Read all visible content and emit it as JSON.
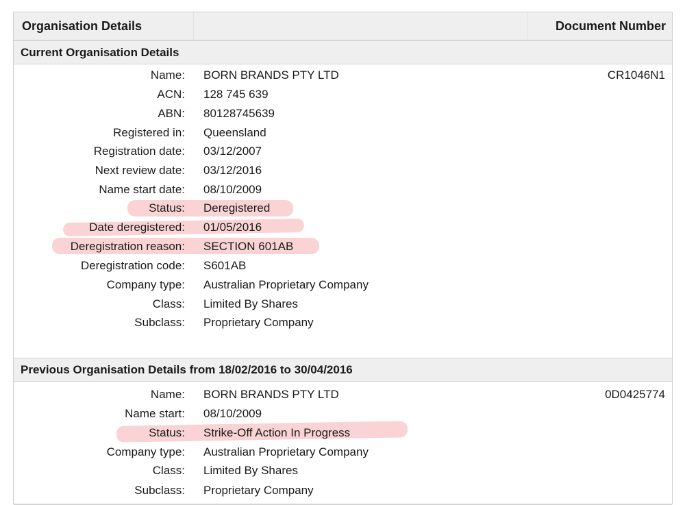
{
  "header": {
    "title": "Organisation Details",
    "document_number_label": "Document Number"
  },
  "current": {
    "section_title": "Current Organisation Details",
    "document_number": "CR1046N1",
    "fields": [
      {
        "label": "Name:",
        "value": "BORN BRANDS PTY LTD"
      },
      {
        "label": "ACN:",
        "value": "128 745 639"
      },
      {
        "label": "ABN:",
        "value": "80128745639"
      },
      {
        "label": "Registered in:",
        "value": "Queensland"
      },
      {
        "label": "Registration date:",
        "value": "03/12/2007"
      },
      {
        "label": "Next review date:",
        "value": "03/12/2016"
      },
      {
        "label": "Name start date:",
        "value": "08/10/2009"
      },
      {
        "label": "Status:",
        "value": "Deregistered"
      },
      {
        "label": "Date deregistered:",
        "value": "01/05/2016"
      },
      {
        "label": "Deregistration reason:",
        "value": "SECTION 601AB"
      },
      {
        "label": "Deregistration code:",
        "value": "S601AB"
      },
      {
        "label": "Company type:",
        "value": "Australian Proprietary Company"
      },
      {
        "label": "Class:",
        "value": "Limited By Shares"
      },
      {
        "label": "Subclass:",
        "value": "Proprietary Company"
      }
    ]
  },
  "previous": {
    "section_title": "Previous Organisation Details from 18/02/2016 to 30/04/2016",
    "document_number": "0D0425774",
    "fields": [
      {
        "label": "Name:",
        "value": "BORN BRANDS PTY LTD"
      },
      {
        "label": "Name start:",
        "value": "08/10/2009"
      },
      {
        "label": "Status:",
        "value": "Strike-Off Action In Progress"
      },
      {
        "label": "Company type:",
        "value": "Australian Proprietary Company"
      },
      {
        "label": "Class:",
        "value": "Limited By Shares"
      },
      {
        "label": "Subclass:",
        "value": "Proprietary Company"
      }
    ]
  },
  "colors": {
    "header_bg": "#efefef",
    "highlight": "#f07878"
  }
}
